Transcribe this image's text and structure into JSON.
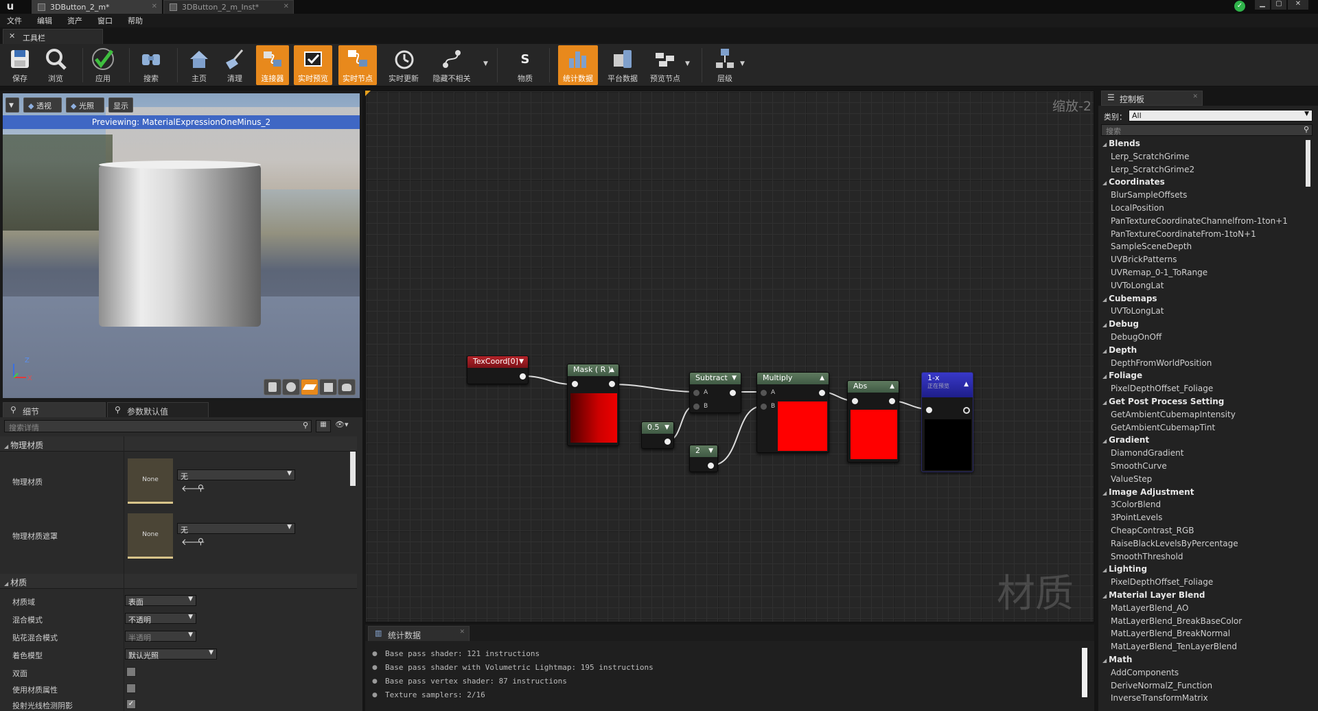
{
  "doc_tabs": [
    {
      "label": "3DButton_2_m*",
      "active": true
    },
    {
      "label": "3DButton_2_m_Inst*",
      "active": false
    }
  ],
  "menu": [
    "文件",
    "编辑",
    "资产",
    "窗口",
    "帮助"
  ],
  "toolbar_tab": "工具栏",
  "toolbar": [
    {
      "label": "保存",
      "icon": "save-icon",
      "active": false
    },
    {
      "label": "浏览",
      "icon": "browse-icon",
      "active": false
    },
    {
      "label": "应用",
      "icon": "apply-icon",
      "active": false
    },
    {
      "label": "搜索",
      "icon": "search-icon",
      "active": false
    },
    {
      "label": "主页",
      "icon": "home-icon",
      "active": false
    },
    {
      "label": "清理",
      "icon": "clean-icon",
      "active": false
    },
    {
      "label": "连接器",
      "icon": "connector-icon",
      "active": true
    },
    {
      "label": "实时预览",
      "icon": "live-preview-icon",
      "active": true
    },
    {
      "label": "实时节点",
      "icon": "live-nodes-icon",
      "active": true
    },
    {
      "label": "实时更新",
      "icon": "live-update-icon",
      "active": false
    },
    {
      "label": "隐藏不相关",
      "icon": "hide-unrelated-icon",
      "active": false
    },
    {
      "label": "物质",
      "icon": "substance-icon",
      "active": false
    },
    {
      "label": "统计数据",
      "icon": "stats-icon",
      "active": true
    },
    {
      "label": "平台数据",
      "icon": "platform-stats-icon",
      "active": false
    },
    {
      "label": "预览节点",
      "icon": "preview-node-icon",
      "active": false
    },
    {
      "label": "层级",
      "icon": "hierarchy-icon",
      "active": false
    }
  ],
  "viewport": {
    "buttons": [
      "透视",
      "光照",
      "显示"
    ],
    "banner": "Previewing: MaterialExpressionOneMinus_2",
    "axis_z": "Z",
    "axis_x": "X"
  },
  "details": {
    "tabs": [
      "细节",
      "参数默认值"
    ],
    "search_placeholder": "搜索详情",
    "section_physical": "物理材质",
    "phys_material_label": "物理材质",
    "phys_material_thumb": "None",
    "phys_material_value": "无",
    "phys_mask_label": "物理材质遮罩",
    "phys_mask_thumb": "None",
    "phys_mask_value": "无",
    "section_material": "材质",
    "rows": [
      {
        "label": "材质域",
        "value": "表面"
      },
      {
        "label": "混合模式",
        "value": "不透明"
      },
      {
        "label": "贴花混合模式",
        "value": "半透明"
      },
      {
        "label": "着色模型",
        "value": "默认光照"
      }
    ],
    "checks": [
      {
        "label": "双面",
        "checked": false
      },
      {
        "label": "使用材质属性",
        "checked": false
      },
      {
        "label": "投射光线检测阴影",
        "checked": true
      }
    ]
  },
  "graph": {
    "zoom": "缩放-2",
    "watermark": "材质",
    "nodes": {
      "texcoord": "TexCoord[0]",
      "mask": "Mask ( R )",
      "subtract": "Subtract",
      "multiply": "Multiply",
      "abs": "Abs",
      "oneminus": "1-x",
      "oneminus_sub": "正在预览",
      "const_half": "0.5",
      "const_two": "2",
      "pin_a": "A",
      "pin_b": "B"
    }
  },
  "stats": {
    "tab": "统计数据",
    "lines": [
      "Base pass shader: 121 instructions",
      "Base pass shader with Volumetric Lightmap: 195 instructions",
      "Base pass vertex shader: 87 instructions",
      "Texture samplers: 2/16"
    ]
  },
  "palette": {
    "tab": "控制板",
    "category_label": "类别：",
    "category_value": "All",
    "search_placeholder": "搜索",
    "groups": [
      {
        "name": "Blends",
        "items": [
          "Lerp_ScratchGrime",
          "Lerp_ScratchGrime2"
        ]
      },
      {
        "name": "Coordinates",
        "items": [
          "BlurSampleOffsets",
          "LocalPosition",
          "PanTextureCoordinateChannelfrom-1ton+1",
          "PanTextureCoordinateFrom-1toN+1",
          "SampleSceneDepth",
          "UVBrickPatterns",
          "UVRemap_0-1_ToRange",
          "UVToLongLat"
        ]
      },
      {
        "name": "Cubemaps",
        "items": [
          "UVToLongLat"
        ]
      },
      {
        "name": "Debug",
        "items": [
          "DebugOnOff"
        ]
      },
      {
        "name": "Depth",
        "items": [
          "DepthFromWorldPosition"
        ]
      },
      {
        "name": "Foliage",
        "items": [
          "PixelDepthOffset_Foliage"
        ]
      },
      {
        "name": "Get Post Process Setting",
        "items": [
          "GetAmbientCubemapIntensity",
          "GetAmbientCubemapTint"
        ]
      },
      {
        "name": "Gradient",
        "items": [
          "DiamondGradient",
          "SmoothCurve",
          "ValueStep"
        ]
      },
      {
        "name": "Image Adjustment",
        "items": [
          "3ColorBlend",
          "3PointLevels",
          "CheapContrast_RGB",
          "RaiseBlackLevelsByPercentage",
          "SmoothThreshold"
        ]
      },
      {
        "name": "Lighting",
        "items": [
          "PixelDepthOffset_Foliage"
        ]
      },
      {
        "name": "Material Layer Blend",
        "items": [
          "MatLayerBlend_AO",
          "MatLayerBlend_BreakBaseColor",
          "MatLayerBlend_BreakNormal",
          "MatLayerBlend_TenLayerBlend"
        ]
      },
      {
        "name": "Math",
        "items": [
          "AddComponents",
          "DeriveNormalZ_Function",
          "InverseTransformMatrix"
        ]
      }
    ]
  }
}
